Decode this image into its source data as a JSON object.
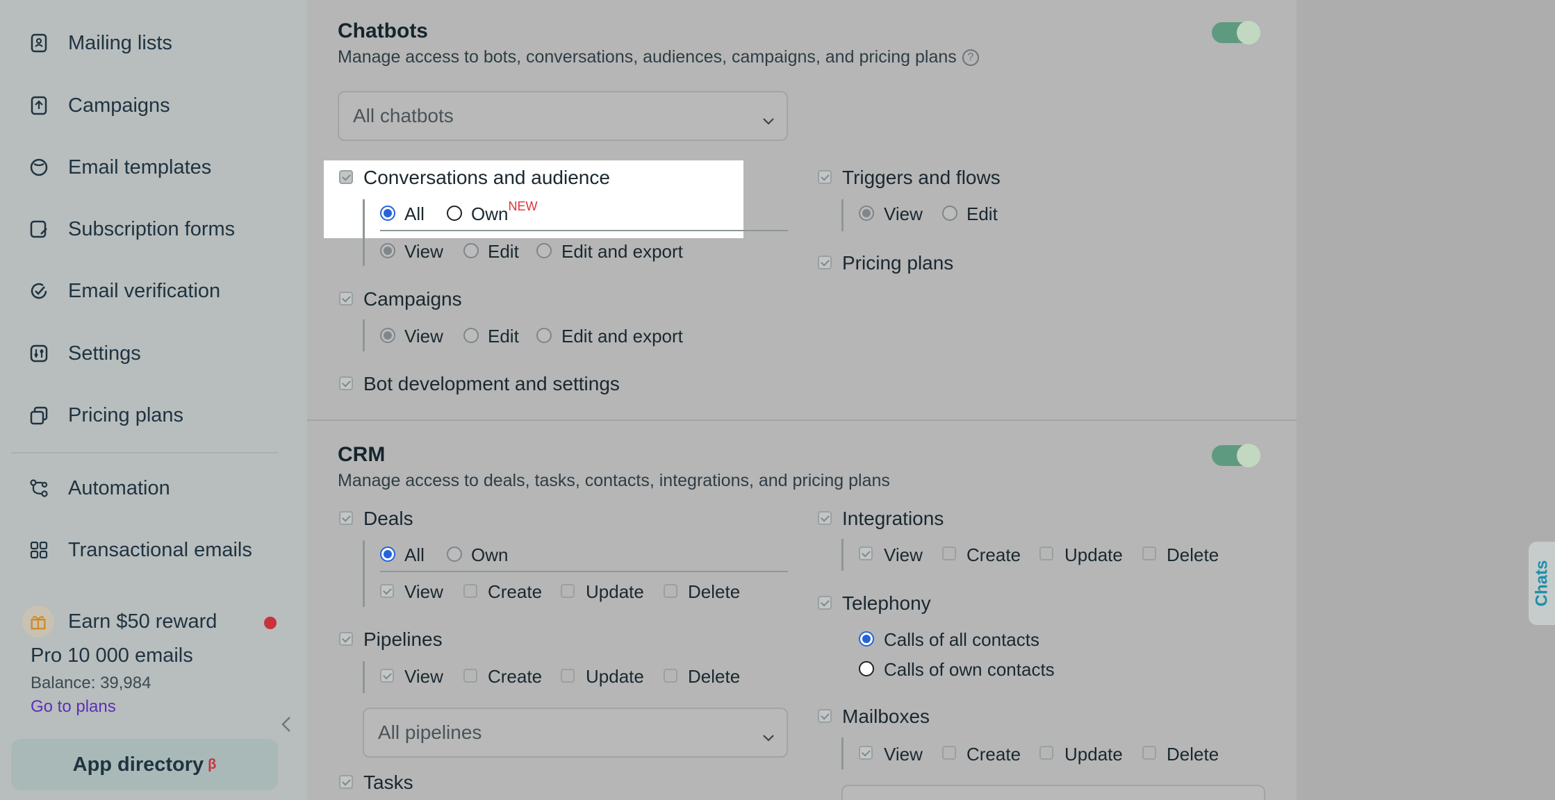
{
  "sidebar": {
    "items": [
      {
        "label": "Mailing lists",
        "icon": "contacts-book-icon"
      },
      {
        "label": "Campaigns",
        "icon": "upload-icon"
      },
      {
        "label": "Email templates",
        "icon": "template-icon"
      },
      {
        "label": "Subscription forms",
        "icon": "form-icon"
      },
      {
        "label": "Email verification",
        "icon": "check-circle-icon"
      },
      {
        "label": "Settings",
        "icon": "sliders-icon"
      },
      {
        "label": "Pricing plans",
        "icon": "stack-icon"
      },
      {
        "label": "Automation",
        "icon": "flow-icon"
      },
      {
        "label": "Transactional emails",
        "icon": "grid-icon"
      },
      {
        "label": "Earn $50 reward",
        "icon": "gift-icon"
      }
    ],
    "plan": {
      "name": "Pro 10 000 emails",
      "balance": "Balance: 39,984",
      "link": "Go to plans"
    },
    "app_directory": {
      "label": "App directory",
      "badge": "β"
    }
  },
  "chatbots": {
    "title": "Chatbots",
    "description": "Manage access to bots, conversations, audiences, campaigns, and pricing plans",
    "help": "?",
    "select": "All chatbots",
    "conversations": {
      "label": "Conversations and audience",
      "all": "All",
      "own": "Own",
      "new": "NEW",
      "view": "View",
      "edit": "Edit",
      "edit_export": "Edit and export"
    },
    "campaigns": {
      "label": "Campaigns",
      "view": "View",
      "edit": "Edit",
      "edit_export": "Edit and export"
    },
    "bot_dev": {
      "label": "Bot development and settings"
    },
    "triggers": {
      "label": "Triggers and flows",
      "view": "View",
      "edit": "Edit"
    },
    "pricing": {
      "label": "Pricing plans"
    }
  },
  "crm": {
    "title": "CRM",
    "description": "Manage access to deals, tasks, contacts, integrations, and pricing plans",
    "deals": {
      "label": "Deals",
      "all": "All",
      "own": "Own",
      "view": "View",
      "create": "Create",
      "update": "Update",
      "delete": "Delete"
    },
    "pipelines": {
      "label": "Pipelines",
      "view": "View",
      "create": "Create",
      "update": "Update",
      "delete": "Delete",
      "select": "All pipelines"
    },
    "tasks": {
      "label": "Tasks"
    },
    "integrations": {
      "label": "Integrations",
      "view": "View",
      "create": "Create",
      "update": "Update",
      "delete": "Delete"
    },
    "telephony": {
      "label": "Telephony",
      "all_contacts": "Calls of all contacts",
      "own_contacts": "Calls of own contacts"
    },
    "mailboxes": {
      "label": "Mailboxes",
      "view": "View",
      "create": "Create",
      "update": "Update",
      "delete": "Delete"
    }
  },
  "chats_tab": "Chats"
}
